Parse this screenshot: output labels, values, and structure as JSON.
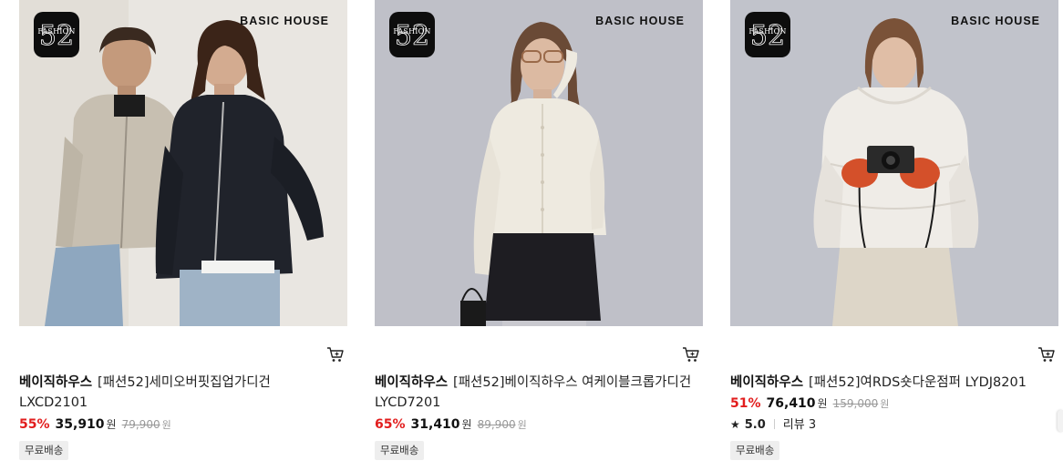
{
  "badge_text": "FASHION",
  "products": [
    {
      "image_alt": "Two models wearing zip-up knit cardigans",
      "brand_mark": "BASIC HOUSE",
      "brand": "베이직하우스",
      "name": "[패션52]세미오버핏집업가디건 LXCD2101",
      "discount": "55%",
      "price": "35,910",
      "currency": "원",
      "original_price": "79,900",
      "original_currency": "원",
      "shipping": "무료배송",
      "cart_icon": "cart-icon"
    },
    {
      "image_alt": "Model wearing ivory cable cropped cardigan and black skirt",
      "brand_mark": "BASIC HOUSE",
      "brand": "베이직하우스",
      "name": "[패션52]베이직하우스 여케이블크롭가디건 LYCD7201",
      "discount": "65%",
      "price": "31,410",
      "currency": "원",
      "original_price": "89,900",
      "original_currency": "원",
      "shipping": "무료배송",
      "cart_icon": "cart-icon"
    },
    {
      "image_alt": "Model wearing ivory short down puffer holding a camera",
      "brand_mark": "BASIC HOUSE",
      "brand": "베이직하우스",
      "name": "[패션52]여RDS숏다운점퍼 LYDJ8201",
      "discount": "51%",
      "price": "76,410",
      "currency": "원",
      "original_price": "159,000",
      "original_currency": "원",
      "rating_icon": "star-icon",
      "rating": "5.0",
      "reviews": "리뷰 3",
      "shipping": "무료배송",
      "cart_icon": "cart-icon"
    }
  ],
  "colors": {
    "discount": "#e21d1d",
    "tag_bg": "#eeeeee",
    "photo_bg_1": "#e9e6e1",
    "photo_bg_2": "#bfc0c8",
    "photo_bg_3": "#c1c3cb"
  }
}
